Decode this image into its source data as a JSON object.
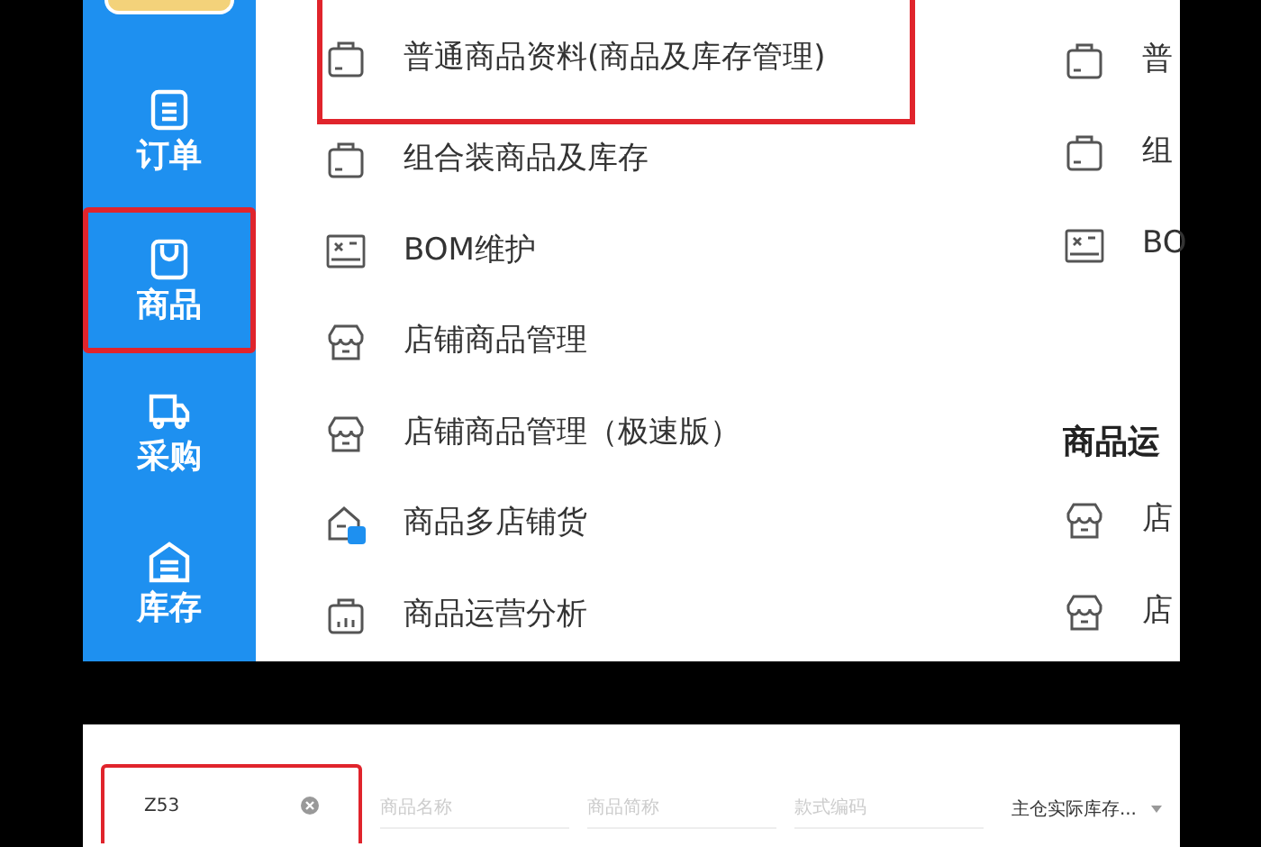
{
  "sidebar": {
    "items": [
      {
        "label": "订单",
        "kind": "list",
        "highlighted": false
      },
      {
        "label": "商品",
        "kind": "bag",
        "highlighted": true
      },
      {
        "label": "采购",
        "kind": "truck",
        "highlighted": false
      },
      {
        "label": "库存",
        "kind": "warehouse",
        "highlighted": false
      }
    ]
  },
  "menu_left": [
    {
      "label": "普通商品资料(商品及库存管理)",
      "kind": "bag",
      "highlighted": true
    },
    {
      "label": "组合装商品及库存",
      "kind": "bag",
      "highlighted": false
    },
    {
      "label": "BOM维护",
      "kind": "bom",
      "highlighted": false
    },
    {
      "label": "店铺商品管理",
      "kind": "store",
      "highlighted": false
    },
    {
      "label": "店铺商品管理（极速版）",
      "kind": "store",
      "highlighted": false
    },
    {
      "label": "商品多店铺货",
      "kind": "multistore",
      "highlighted": false
    },
    {
      "label": "商品运营分析",
      "kind": "chart",
      "highlighted": false
    }
  ],
  "menu_right": [
    {
      "label": "普",
      "kind": "bag"
    },
    {
      "label": "组",
      "kind": "bag"
    },
    {
      "label": "BO",
      "kind": "bom"
    },
    {
      "label": "商品运",
      "kind": "heading"
    },
    {
      "label": "店",
      "kind": "store"
    },
    {
      "label": "店",
      "kind": "store"
    }
  ],
  "filter_bar": {
    "search": {
      "value": "Z53",
      "highlighted": true
    },
    "fields": [
      {
        "placeholder": "商品名称"
      },
      {
        "placeholder": "商品简称"
      },
      {
        "placeholder": "款式编码"
      }
    ],
    "dropdown": {
      "value": "主仓实际库存..."
    }
  }
}
